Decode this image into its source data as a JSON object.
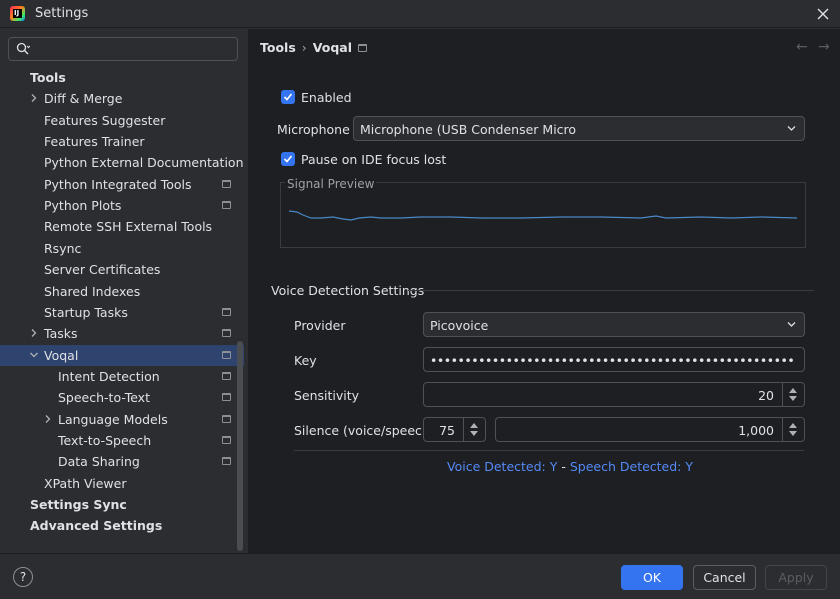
{
  "window": {
    "title": "Settings",
    "icon_text": "IJ"
  },
  "search": {
    "placeholder": "",
    "value": ""
  },
  "sidebar": {
    "items": [
      {
        "label": "Tools",
        "bold": true
      },
      {
        "label": "Diff & Merge",
        "expandable": true
      },
      {
        "label": "Features Suggester"
      },
      {
        "label": "Features Trainer"
      },
      {
        "label": "Python External Documentation"
      },
      {
        "label": "Python Integrated Tools",
        "project_icon": true
      },
      {
        "label": "Python Plots",
        "project_icon": true
      },
      {
        "label": "Remote SSH External Tools"
      },
      {
        "label": "Rsync"
      },
      {
        "label": "Server Certificates"
      },
      {
        "label": "Shared Indexes"
      },
      {
        "label": "Startup Tasks",
        "project_icon": true
      },
      {
        "label": "Tasks",
        "expandable": true,
        "project_icon": true
      },
      {
        "label": "Voqal",
        "expanded": true,
        "selected": true,
        "project_icon": true
      },
      {
        "label": "Intent Detection",
        "project_icon": true
      },
      {
        "label": "Speech-to-Text",
        "project_icon": true
      },
      {
        "label": "Language Models",
        "expandable": true,
        "project_icon": true
      },
      {
        "label": "Text-to-Speech",
        "project_icon": true
      },
      {
        "label": "Data Sharing",
        "project_icon": true
      },
      {
        "label": "XPath Viewer"
      },
      {
        "label": "Settings Sync",
        "bold": true
      },
      {
        "label": "Advanced Settings",
        "bold": true
      }
    ]
  },
  "breadcrumb": {
    "parent": "Tools",
    "separator": "›",
    "current": "Voqal"
  },
  "form": {
    "enabled_label": "Enabled",
    "enabled_checked": true,
    "microphone_label": "Microphone",
    "microphone_value": "Microphone (USB Condenser Micro",
    "pause_label": "Pause on IDE focus lost",
    "pause_checked": true,
    "signal_preview_label": "Signal Preview"
  },
  "voice_detection": {
    "section_title": "Voice Detection Settings",
    "provider_label": "Provider",
    "provider_value": "Picovoice",
    "key_label": "Key",
    "key_value": "•••••••••••••••••••••••••••••••••••••••••••••••••••••",
    "sensitivity_label": "Sensitivity",
    "sensitivity_value": "20",
    "silence_label": "Silence (voice/speech)",
    "silence_voice_value": "75",
    "silence_speech_value": "1,000",
    "status_voice": "Voice Detected: Y",
    "status_sep": "-",
    "status_speech": "Speech Detected: Y"
  },
  "footer": {
    "help": "?",
    "ok": "OK",
    "cancel": "Cancel",
    "apply": "Apply"
  },
  "colors": {
    "accent": "#3574f0",
    "link": "#548af7",
    "selection": "#2e436e",
    "signal": "#4a88c7"
  }
}
